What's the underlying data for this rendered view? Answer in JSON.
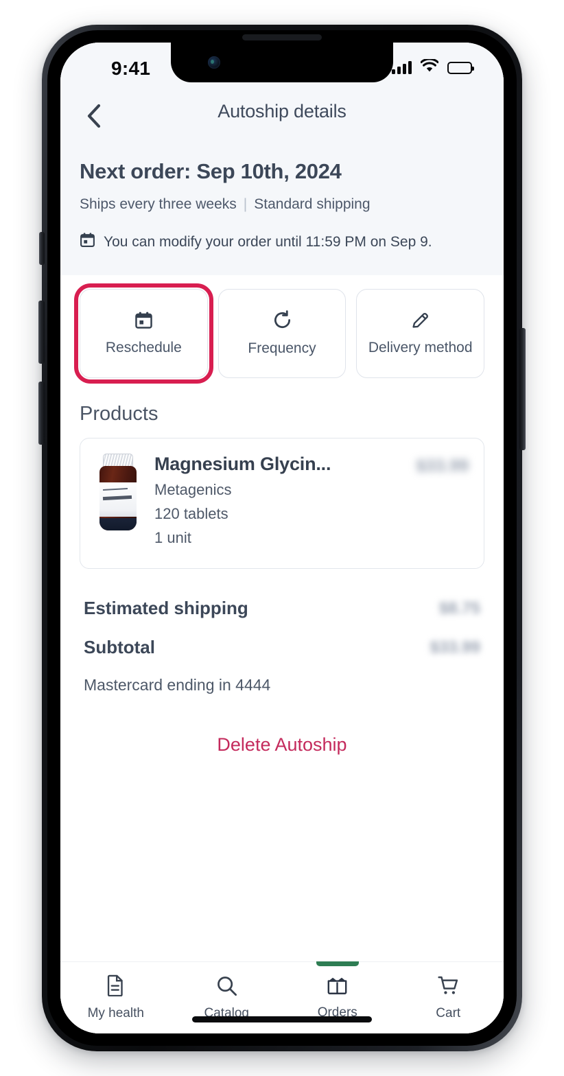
{
  "status_bar": {
    "time": "9:41",
    "signal_icon": "signal-bars-icon",
    "wifi_icon": "wifi-icon",
    "battery_icon": "battery-full-icon"
  },
  "nav": {
    "back_icon": "chevron-left-icon",
    "title": "Autoship details"
  },
  "order_summary": {
    "next_order": "Next order: Sep 10th, 2024",
    "frequency_text": "Ships every three weeks",
    "separator": "|",
    "shipping_text": "Standard shipping",
    "calendar_icon": "calendar-icon",
    "modify_note": "You can modify your order until 11:59 PM on Sep 9."
  },
  "actions": [
    {
      "label": "Reschedule",
      "icon": "calendar-icon",
      "focused": true
    },
    {
      "label": "Frequency",
      "icon": "refresh-icon",
      "focused": false
    },
    {
      "label": "Delivery method",
      "icon": "pencil-icon",
      "focused": false
    }
  ],
  "products": {
    "heading": "Products",
    "items": [
      {
        "name": "Magnesium Glycin...",
        "brand": "Metagenics",
        "size": "120 tablets",
        "quantity": "1 unit",
        "price": "$33.99",
        "image_label": "Mag Glycinate",
        "image_brand": "Metagenics"
      }
    ]
  },
  "totals": {
    "rows": [
      {
        "label": "Estimated shipping",
        "value": "$8.75"
      },
      {
        "label": "Subtotal",
        "value": "$33.99"
      }
    ],
    "payment_method": "Mastercard ending in 4444"
  },
  "delete_link": "Delete Autoship",
  "tab_bar": {
    "items": [
      {
        "label": "My health",
        "icon": "document-icon",
        "active": false
      },
      {
        "label": "Catalog",
        "icon": "search-icon",
        "active": false
      },
      {
        "label": "Orders",
        "icon": "open-box-icon",
        "active": true
      },
      {
        "label": "Cart",
        "icon": "shopping-cart-icon",
        "active": false
      }
    ]
  },
  "colors": {
    "accent_focus": "#d81e50",
    "delete_link": "#c42a5c",
    "tab_active": "#2e7d53",
    "header_bg": "#f5f7fa",
    "text_primary": "#3c4758"
  }
}
